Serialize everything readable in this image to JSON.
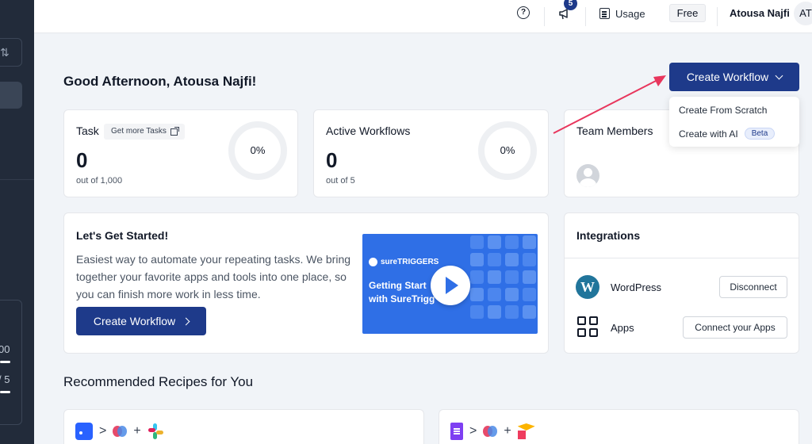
{
  "sidebar": {
    "sort_glyph": "⇅",
    "number_1": "00",
    "number_2": "/ 5"
  },
  "topbar": {
    "help_glyph": "?",
    "notification_count": "5",
    "usage_label": "Usage",
    "plan_label": "Free",
    "user_name": "Atousa Najfi",
    "user_initials": "AT"
  },
  "greeting": "Good Afternoon, Atousa Najfi!",
  "create_workflow": {
    "label": "Create Workflow",
    "menu": [
      {
        "label": "Create From Scratch"
      },
      {
        "label": "Create with AI",
        "badge": "Beta"
      }
    ]
  },
  "task_card": {
    "title": "Task",
    "link_label": "Get more Tasks",
    "value": "0",
    "subtext": "out of 1,000",
    "percent_label": "0%",
    "progress_fraction": 0
  },
  "workflows_card": {
    "title": "Active Workflows",
    "value": "0",
    "subtext": "out of 5",
    "percent_label": "0%",
    "progress_fraction": 0
  },
  "team_card": {
    "title": "Team Members"
  },
  "get_started": {
    "title": "Let's Get Started!",
    "description": "Easiest way to automate your repeating tasks. We bring together your favorite apps and tools into one place, so you can finish more work in less time.",
    "button_label": "Create Workflow",
    "video": {
      "brand": "sureTRIGGERS",
      "line1": "Getting Start",
      "line2": "with SureTrigg"
    }
  },
  "integrations": {
    "title": "Integrations",
    "items": [
      {
        "name": "WordPress",
        "action": "Disconnect",
        "icon": "wordpress-icon"
      },
      {
        "name": "Apps",
        "action": "Connect your Apps",
        "icon": "apps-grid-icon"
      }
    ]
  },
  "recipes": {
    "title": "Recommended Recipes for You",
    "chevron_glyph": ">",
    "plus_glyph": "+"
  },
  "colors": {
    "primary": "#1e3a8a",
    "sidebar": "#222b3a",
    "annotation_arrow": "#e8365d"
  }
}
